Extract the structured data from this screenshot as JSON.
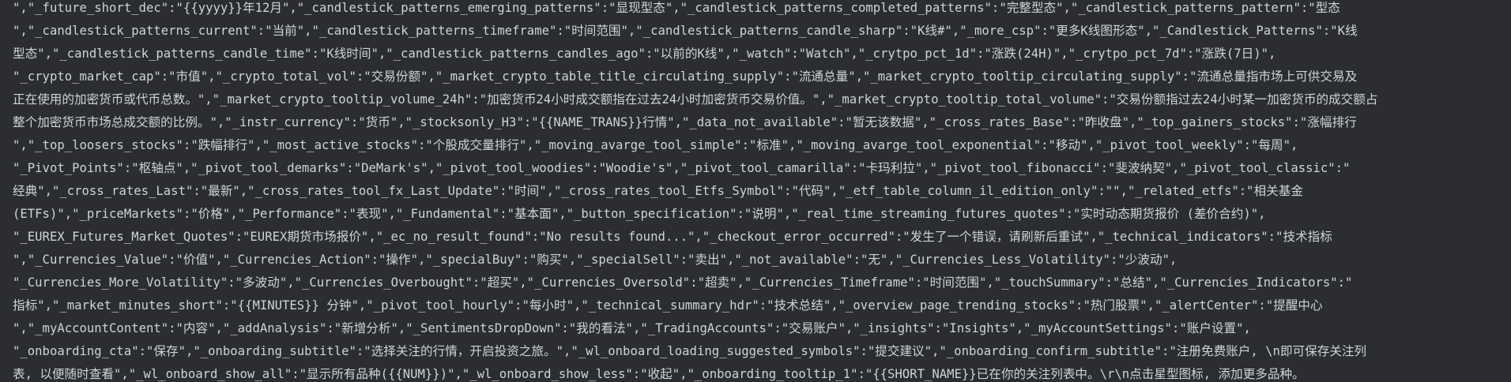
{
  "editor": {
    "lines": [
      "\",\"_future_short_dec\":\"{{yyyy}}年12月\",\"_candlestick_patterns_emerging_patterns\":\"显现型态\",\"_candlestick_patterns_completed_patterns\":\"完整型态\",\"_candlestick_patterns_pattern\":\"型态",
      "\",\"_candlestick_patterns_current\":\"当前\",\"_candlestick_patterns_timeframe\":\"时间范围\",\"_candlestick_patterns_candle_sharp\":\"K线#\",\"_more_csp\":\"更多K线图形态\",\"_Candlestick_Patterns\":\"K线",
      "型态\",\"_candlestick_patterns_candle_time\":\"K线时间\",\"_candlestick_patterns_candles_ago\":\"以前的K线\",\"_watch\":\"Watch\",\"_crytpo_pct_1d\":\"涨跌(24H)\",\"_crytpo_pct_7d\":\"涨跌(7日)\",",
      "\"_crypto_market_cap\":\"市值\",\"_crypto_total_vol\":\"交易份额\",\"_market_crypto_table_title_circulating_supply\":\"流通总量\",\"_market_crypto_tooltip_circulating_supply\":\"流通总量指市场上可供交易及",
      "正在使用的加密货币或代币总数。\",\"_market_crypto_tooltip_volume_24h\":\"加密货币24小时成交额指在过去24小时加密货币交易价值。\",\"_market_crypto_tooltip_total_volume\":\"交易份额指过去24小时某一加密货币的成交额占",
      "整个加密货币市场总成交额的比例。\",\"_instr_currency\":\"货币\",\"_stocksonly_H3\":\"{{NAME_TRANS}}行情\",\"_data_not_available\":\"暂无该数据\",\"_cross_rates_Base\":\"昨收盘\",\"_top_gainers_stocks\":\"涨幅排行",
      "\",\"_top_loosers_stocks\":\"跌幅排行\",\"_most_active_stocks\":\"个股成交量排行\",\"_moving_avarge_tool_simple\":\"标准\",\"_moving_avarge_tool_exponential\":\"移动\",\"_pivot_tool_weekly\":\"每周\",",
      "\"_Pivot_Points\":\"枢轴点\",\"_pivot_tool_demarks\":\"DeMark's\",\"_pivot_tool_woodies\":\"Woodie's\",\"_pivot_tool_camarilla\":\"卡玛利拉\",\"_pivot_tool_fibonacci\":\"斐波纳契\",\"_pivot_tool_classic\":\"",
      "经典\",\"_cross_rates_Last\":\"最新\",\"_cross_rates_tool_fx_Last_Update\":\"时间\",\"_cross_rates_tool_Etfs_Symbol\":\"代码\",\"_etf_table_column_il_edition_only\":\"\",\"_related_etfs\":\"相关基金",
      "(ETFs)\",\"_priceMarkets\":\"价格\",\"_Performance\":\"表现\",\"_Fundamental\":\"基本面\",\"_button_specification\":\"说明\",\"_real_time_streaming_futures_quotes\":\"实时动态期货报价 (差价合约)\",",
      "\"_EUREX_Futures_Market_Quotes\":\"EUREX期货市场报价\",\"_ec_no_result_found\":\"No results found...\",\"_checkout_error_occurred\":\"发生了一个错误，请刷新后重试\",\"_technical_indicators\":\"技术指标",
      "\",\"_Currencies_Value\":\"价值\",\"_Currencies_Action\":\"操作\",\"_specialBuy\":\"购买\",\"_specialSell\":\"卖出\",\"_not_available\":\"无\",\"_Currencies_Less_Volatility\":\"少波动\",",
      "\"_Currencies_More_Volatility\":\"多波动\",\"_Currencies_Overbought\":\"超买\",\"_Currencies_Oversold\":\"超卖\",\"_Currencies_Timeframe\":\"时间范围\",\"_touchSummary\":\"总结\",\"_Currencies_Indicators\":\"",
      "指标\",\"_market_minutes_short\":\"{{MINUTES}} 分钟\",\"_pivot_tool_hourly\":\"每小时\",\"_technical_summary_hdr\":\"技术总结\",\"_overview_page_trending_stocks\":\"热门股票\",\"_alertCenter\":\"提醒中心",
      "\",\"_myAccountContent\":\"内容\",\"_addAnalysis\":\"新增分析\",\"_SentimentsDropDown\":\"我的看法\",\"_TradingAccounts\":\"交易账户\",\"_insights\":\"Insights\",\"_myAccountSettings\":\"账户设置\",",
      "\"_onboarding_cta\":\"保存\",\"_onboarding_subtitle\":\"选择关注的行情，开启投资之旅。\",\"_wl_onboard_loading_suggested_symbols\":\"提交建议\",\"_onboarding_confirm_subtitle\":\"注册免费账户, \\n即可保存关注列",
      "表, 以便随时查看\",\"_wl_onboard_show_all\":\"显示所有品种({{NUM}})\",\"_wl_onboard_show_less\":\"收起\",\"_onboarding_tooltip_1\":\"{{SHORT_NAME}}已在你的关注列表中。\\r\\n点击星型图标, 添加更多品种。"
    ]
  }
}
